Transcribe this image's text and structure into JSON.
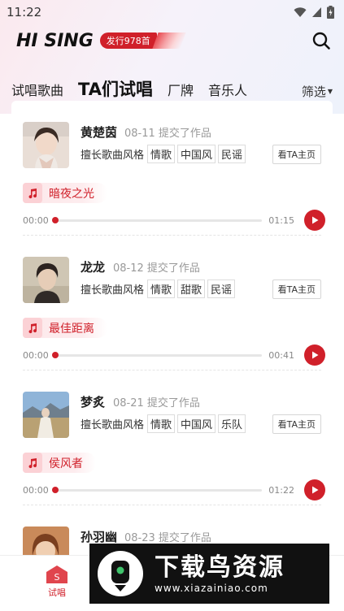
{
  "status_bar": {
    "time": "11:22"
  },
  "header": {
    "logo": "HI SING",
    "release_badge": "发行978首"
  },
  "tabs": [
    {
      "label": "试唱歌曲",
      "active": false
    },
    {
      "label": "TA们试唱",
      "active": true
    },
    {
      "label": "厂牌",
      "active": false
    },
    {
      "label": "音乐人",
      "active": false
    }
  ],
  "filter_label": "筛选",
  "style_label": "擅长歌曲风格",
  "home_button": "看TA主页",
  "items": [
    {
      "name": "黄楚茵",
      "date": "08-11",
      "action": "提交了作品",
      "tags": [
        "情歌",
        "中国风",
        "民谣"
      ],
      "song": "暗夜之光",
      "current_time": "00:00",
      "duration": "01:15",
      "progress": 0
    },
    {
      "name": "龙龙",
      "date": "08-12",
      "action": "提交了作品",
      "tags": [
        "情歌",
        "甜歌",
        "民谣"
      ],
      "song": "最佳距离",
      "current_time": "00:00",
      "duration": "00:41",
      "progress": 0
    },
    {
      "name": "梦炙",
      "date": "08-21",
      "action": "提交了作品",
      "tags": [
        "情歌",
        "中国风",
        "乐队"
      ],
      "song": "侯风者",
      "current_time": "00:00",
      "duration": "01:22",
      "progress": 0
    },
    {
      "name": "孙羽幽",
      "date": "08-23",
      "action": "提交了作品"
    }
  ],
  "bottom_nav": {
    "home_label": "试唱",
    "home_glyph": "S"
  },
  "watermark": {
    "title": "下载鸟资源",
    "url": "www.xiazainiao.com"
  },
  "colors": {
    "accent": "#d0202a",
    "chip_bg": "#fde8ea"
  }
}
